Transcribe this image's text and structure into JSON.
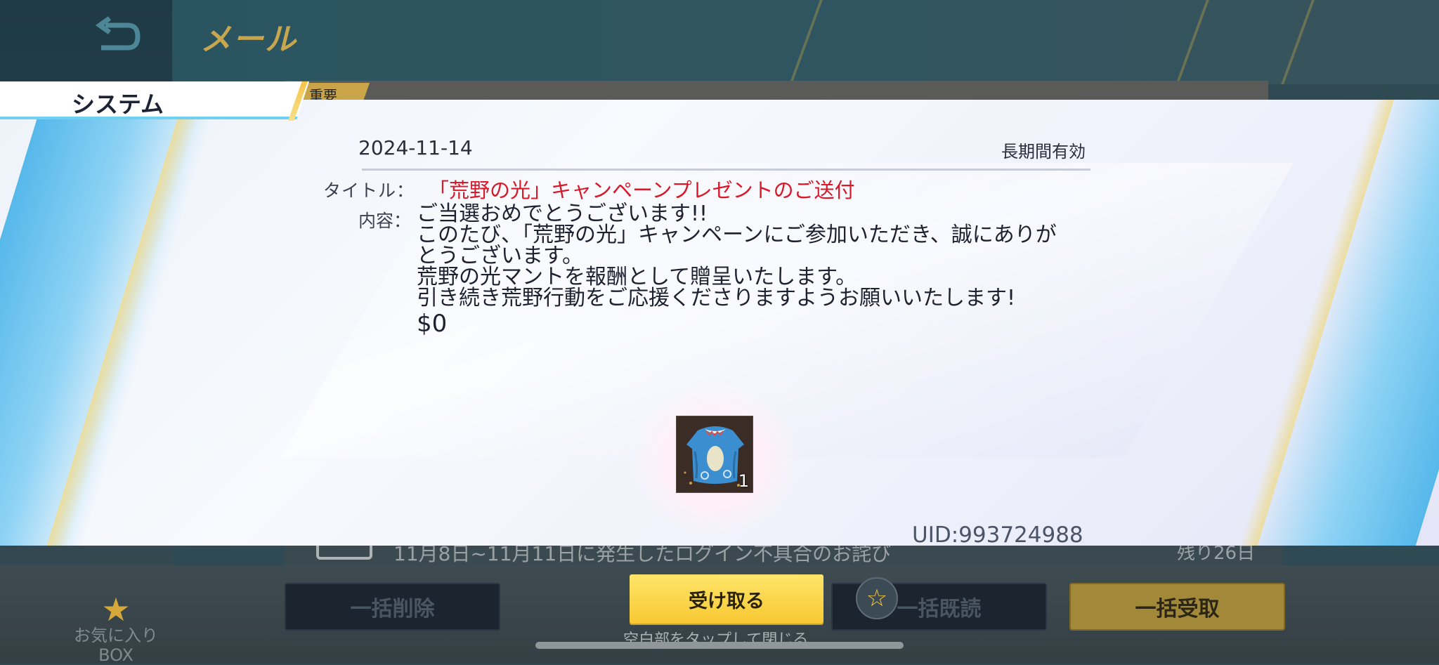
{
  "header": {
    "title": "メール"
  },
  "tabs": {
    "system_label": "システム",
    "important_label": "重要"
  },
  "mail": {
    "date": "2024-11-14",
    "validity": "長期間有効",
    "title_label": "タイトル：",
    "subject": "「荒野の光」キャンペーンプレゼントのご送付",
    "content_label": "内容：",
    "body_lines": [
      "ご当選おめでとうございます!!",
      "このたび、「荒野の光」キャンペーンにご参加いただき、誠にありが",
      "とうございます。",
      "荒野の光マントを報酬として贈呈いたします。",
      "引き続き荒野行動をご応援くださりますようお願いいたします!",
      "$0"
    ],
    "reward": {
      "icon": "cloak-icon",
      "count": "1"
    },
    "uid": "UID:993724988"
  },
  "list_behind": {
    "row_text": "11月8日~11月11日に発生したログイン不具合のお詫び",
    "row_days": "残り26日"
  },
  "bottom": {
    "favorites_label_1": "お気に入り",
    "favorites_label_2": "BOX",
    "delete_all": "一括削除",
    "receive": "受け取る",
    "read_all": "一括既読",
    "claim_all": "一括受取",
    "close_hint": "空白部をタップして閉じる"
  },
  "colors": {
    "subject": "#d8192a",
    "receive_button": "#f7c832",
    "accent_blue": "#56b8ea"
  }
}
